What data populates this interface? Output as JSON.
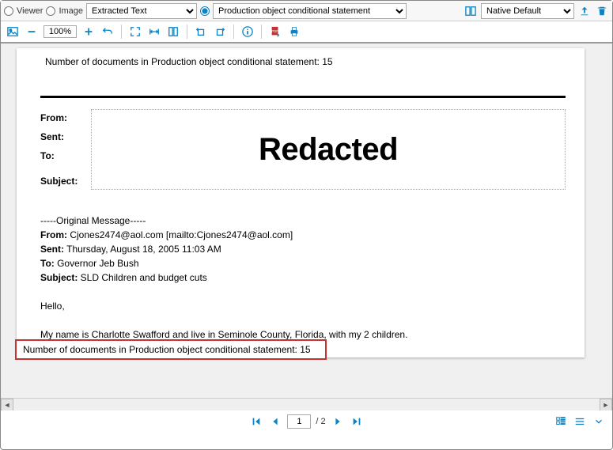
{
  "topToolbar": {
    "radios": {
      "viewer": "Viewer",
      "image": "Image"
    },
    "extractedDropdown": {
      "selected": "Extracted Text"
    },
    "productionDropdown": {
      "selected": "Production object conditional statement"
    },
    "nativeDropdown": {
      "selected": "Native Default"
    }
  },
  "secondToolbar": {
    "zoom": "100%"
  },
  "document": {
    "topCount": "Number of documents in Production object conditional statement: 15",
    "labels": {
      "from": "From:",
      "sent": "Sent:",
      "to": "To:",
      "subject": "Subject:"
    },
    "redactedText": "Redacted",
    "origMessageHeader": "-----Original Message-----",
    "fromLabel": "From:",
    "fromValue": " Cjones2474@aol.com [mailto:Cjones2474@aol.com]",
    "sentLabel": "Sent:",
    "sentValue": " Thursday, August 18, 2005 11:03 AM",
    "toLabel": "To:",
    "toValue": " Governor Jeb Bush",
    "subjectLabel": "Subject:",
    "subjectValue": " SLD Children and budget cuts",
    "greeting": "Hello,",
    "body1": "My name is Charlotte Swafford and live in Seminole County, Florida, with my 2 children.",
    "overlayText": "Number of documents in Production object conditional statement: 15"
  },
  "pager": {
    "current": "1",
    "total": "/ 2"
  }
}
